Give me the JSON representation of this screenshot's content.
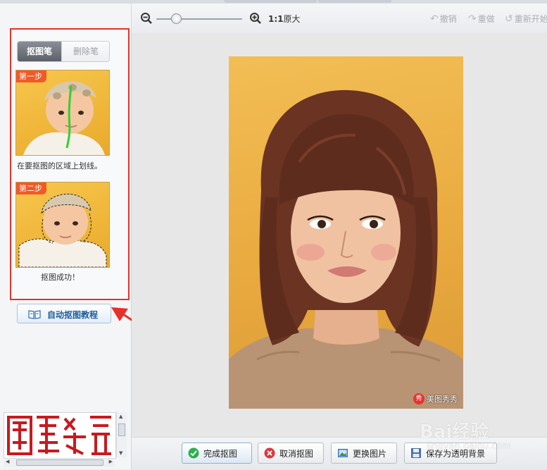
{
  "left_panel": {
    "tabs": [
      {
        "label": "抠图笔",
        "active": true
      },
      {
        "label": "删除笔",
        "active": false
      }
    ],
    "steps": [
      {
        "badge": "第一步",
        "caption": "在要抠图的区域上划线。"
      },
      {
        "badge": "第二步",
        "caption": "抠图成功！"
      }
    ],
    "tutorial_button": {
      "label": "自动抠图教程",
      "icon": "book-icon"
    },
    "preview_image": {
      "description_icon": "seal-stamp-preview"
    }
  },
  "toolbar": {
    "zoom_out_icon": "zoom-out-icon",
    "zoom_in_icon": "zoom-in-icon",
    "ratio_label_bold": "1:1",
    "ratio_label": "原大",
    "undo_label": "撤销",
    "redo_label": "重做",
    "restart_label": "重新开始"
  },
  "canvas": {
    "watermark_seal": "秀",
    "watermark_text": "美图秀秀"
  },
  "bottom_bar": {
    "buttons": [
      {
        "label": "完成抠图",
        "icon": "check-icon"
      },
      {
        "label": "取消抠图",
        "icon": "cancel-icon"
      },
      {
        "label": "更换图片",
        "icon": "image-icon"
      },
      {
        "label": "保存为透明背景",
        "icon": "save-icon"
      }
    ]
  },
  "overlay_watermark": {
    "brand": "Bai经验",
    "sub": "jingyan.baidu.com"
  },
  "colors": {
    "annotation_red": "#e8302a",
    "badge_orange": "#f05a28",
    "tutorial_blue": "#1f5c9c"
  }
}
